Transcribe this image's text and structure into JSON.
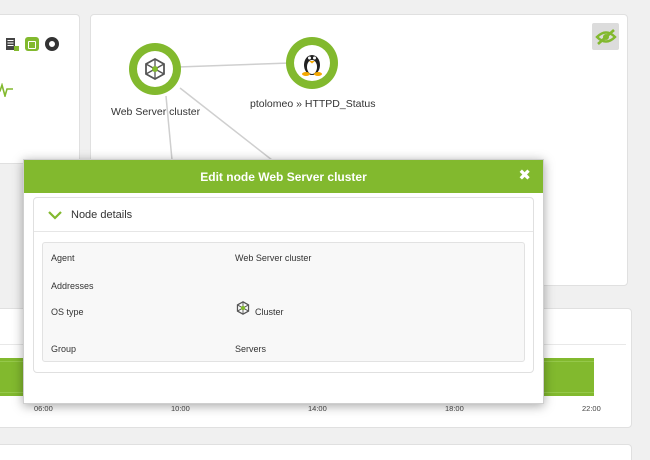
{
  "map": {
    "nodes": [
      {
        "label": "Web Server cluster"
      },
      {
        "label": "ptolomeo » HTTPD_Status"
      }
    ]
  },
  "graph": {
    "ticks": [
      "06:00",
      "10:00",
      "14:00",
      "18:00",
      "22:00"
    ]
  },
  "modal": {
    "title": "Edit node Web Server cluster",
    "section_title": "Node details",
    "rows": [
      {
        "key": "Agent",
        "value": "Web Server cluster"
      },
      {
        "key": "Addresses",
        "value": ""
      },
      {
        "key": "OS type",
        "value": "Cluster"
      },
      {
        "key": "Group",
        "value": "Servers"
      }
    ]
  },
  "colors": {
    "accent": "#82b92e"
  },
  "icons": [
    "server-icon",
    "plug-icon",
    "ring-icon",
    "pulse-icon",
    "hide-icon",
    "cluster-icon",
    "linux-icon",
    "close-icon",
    "chevron-down-icon"
  ]
}
